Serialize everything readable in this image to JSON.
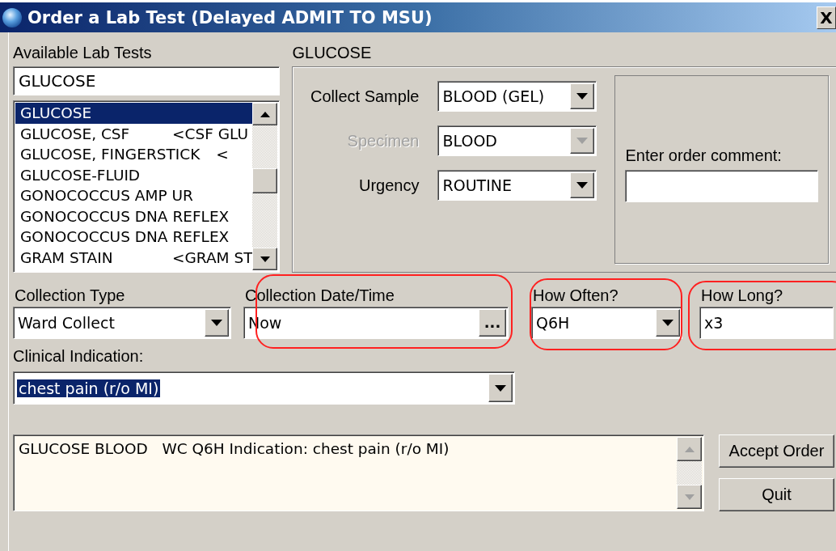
{
  "window": {
    "title": "Order a Lab Test (Delayed ADMIT TO MSU)",
    "close": "X"
  },
  "available_tests": {
    "label": "Available Lab Tests",
    "search": {
      "value": "GLUCOSE"
    },
    "items": [
      {
        "name": "GLUCOSE",
        "selected": true
      },
      {
        "name": "GLUCOSE, CSF",
        "code": "<CSF GLU",
        "selected": false
      },
      {
        "name": "GLUCOSE, FINGERSTICK",
        "code": "<",
        "selected": false
      },
      {
        "name": "GLUCOSE-FLUID",
        "selected": false
      },
      {
        "name": "GONOCOCCUS AMP UR",
        "selected": false
      },
      {
        "name": "GONOCOCCUS DNA REFLEX",
        "selected": false
      },
      {
        "name": "GONOCOCCUS DNA REFLEX",
        "selected": false
      },
      {
        "name": "GRAM STAIN",
        "code": "<GRAM ST",
        "selected": false
      }
    ]
  },
  "test_panel": {
    "title": "GLUCOSE",
    "fields": [
      {
        "label": "Collect Sample",
        "value": "BLOOD (GEL)",
        "disabled": false
      },
      {
        "label": "Specimen",
        "value": "BLOOD",
        "disabled": true
      },
      {
        "label": "Urgency",
        "value": "ROUTINE",
        "disabled": false
      }
    ],
    "comment": {
      "label": "Enter order comment:"
    }
  },
  "schedule": [
    {
      "kind": "dropdown",
      "label": "Collection Type",
      "value": "Ward Collect",
      "circled": false
    },
    {
      "kind": "picker",
      "label": "Collection Date/Time",
      "value": "Now",
      "button": "...",
      "circled": true
    },
    {
      "kind": "dropdown",
      "label": "How Often?",
      "value": "Q6H",
      "circled": true
    },
    {
      "kind": "text",
      "label": "How Long?",
      "value": "x3",
      "circled": true
    }
  ],
  "clinical_indication": {
    "label": "Clinical Indication:",
    "value": "chest pain (r/o MI)",
    "highlighted": true
  },
  "order_summary": "GLUCOSE BLOOD   WC Q6H Indication: chest pain (r/o MI)",
  "buttons": [
    "Accept Order",
    "Quit"
  ]
}
